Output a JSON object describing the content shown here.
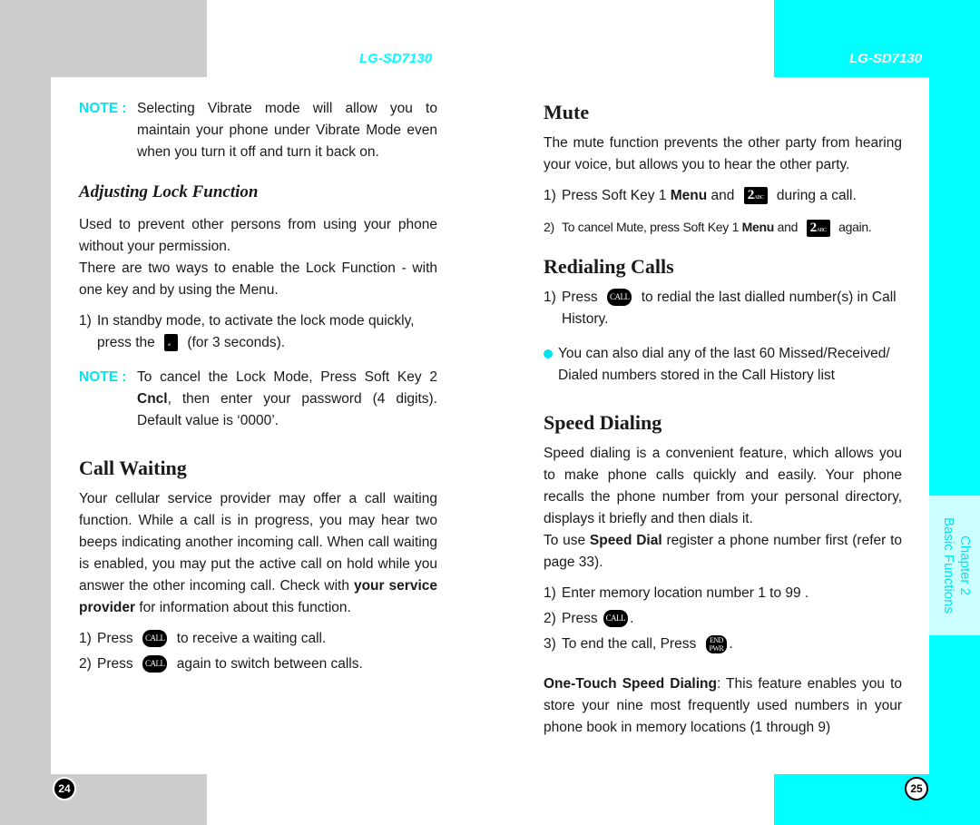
{
  "header": {
    "left_model": "LG-SD7130",
    "right_model": "LG-SD7130"
  },
  "colors": {
    "accent": "#00ffff",
    "note_label": "#00e5ef",
    "gray_frame": "#cccccc",
    "side_tab_bg": "#ccffff"
  },
  "left_page": {
    "page_number": "24",
    "note1": {
      "label": "NOTE :",
      "text": "Selecting Vibrate mode will allow you to maintain your phone under Vibrate Mode even when you turn it off and turn it back on."
    },
    "lock": {
      "title": "Adjusting Lock Function",
      "para1": "Used to prevent other persons from using your phone without your permission.",
      "para2": "There are two ways to enable the Lock Function - with one key and by using the Menu.",
      "step1_num": "1)",
      "step1_pre": "In standby mode, to activate the lock mode quickly, press the",
      "step1_key": "#",
      "step1_post": "(for 3 seconds)."
    },
    "note2": {
      "label": "NOTE :",
      "pre": "To cancel the Lock Mode, Press Soft Key 2",
      "bold": "Cncl",
      "post": ", then enter your password (4 digits). Default value is ‘0000’."
    },
    "call_waiting": {
      "title": "Call Waiting",
      "para_pre": "Your cellular service provider may offer a call waiting function. While a call is in progress, you may hear two beeps indicating another incoming call. When call waiting is enabled, you may put the active call on hold while you answer the other incoming call. Check with",
      "para_bold": "your service provider",
      "para_post": "for information about this function.",
      "steps": [
        {
          "num": "1)",
          "pre": "Press",
          "key": "CALL",
          "post": "to receive a waiting call."
        },
        {
          "num": "2)",
          "pre": "Press",
          "key": "CALL",
          "post": "again to switch between calls."
        }
      ]
    }
  },
  "right_page": {
    "page_number": "25",
    "side_tab": {
      "line1": "Chapter 2",
      "line2": "Basic Functions"
    },
    "mute": {
      "title": "Mute",
      "para": "The mute function prevents the other party from hearing your voice, but allows you to hear the other party.",
      "steps": [
        {
          "num": "1)",
          "pre": "Press Soft Key 1",
          "bold": "Menu",
          "mid": "and",
          "key": "2",
          "post": "during a call."
        },
        {
          "num": "2)",
          "pre": "To cancel Mute, press Soft Key 1",
          "bold": "Menu",
          "mid": "and",
          "key": "2",
          "post": "again."
        }
      ]
    },
    "redial": {
      "title": "Redialing Calls",
      "step1": {
        "num": "1)",
        "pre": "Press",
        "key": "CALL",
        "post": "to redial the last dialled number(s) in Call History."
      },
      "bullet": "You can also dial any of the last 60 Missed/Received/ Dialed numbers stored in the Call History list"
    },
    "speed": {
      "title": "Speed Dialing",
      "para1": "Speed dialing is a convenient feature, which allows you to make phone calls quickly and easily. Your phone recalls the phone number from your personal directory, displays it briefly and then dials it.",
      "para2_pre": "To use",
      "para2_bold": "Speed Dial",
      "para2_post": "register a phone number first (refer to page 33).",
      "steps": [
        {
          "num": "1)",
          "text": "Enter memory location number 1 to 99 ."
        },
        {
          "num": "2)",
          "pre": "Press",
          "key": "CALL",
          "post": "."
        },
        {
          "num": "3)",
          "pre": "To end the call, Press",
          "key_top": "END",
          "key_bottom": "PWR",
          "post": "."
        }
      ],
      "one_touch_bold": "One-Touch Speed Dialing",
      "one_touch_text": ": This feature enables you to store your nine most frequently used numbers in your phone book in memory locations (1 through 9)"
    }
  },
  "icons": {
    "call_key": "call-key-icon",
    "end_key": "end-pwr-key-icon",
    "two_abc_key": "two-abc-key-icon",
    "pound_key": "pound-space-key-icon",
    "bullet": "bullet-dot-icon"
  }
}
